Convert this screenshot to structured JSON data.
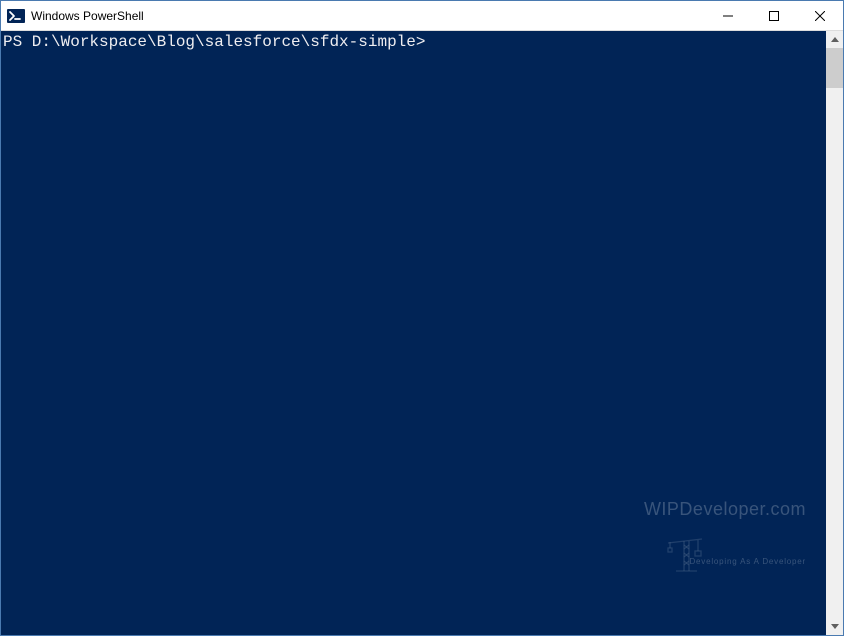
{
  "window": {
    "title": "Windows PowerShell"
  },
  "terminal": {
    "prompt": "PS D:\\Workspace\\Blog\\salesforce\\sfdx-simple>",
    "input": ""
  },
  "watermark": {
    "main": "WIPDeveloper.com",
    "sub": "Developing As A Developer"
  }
}
